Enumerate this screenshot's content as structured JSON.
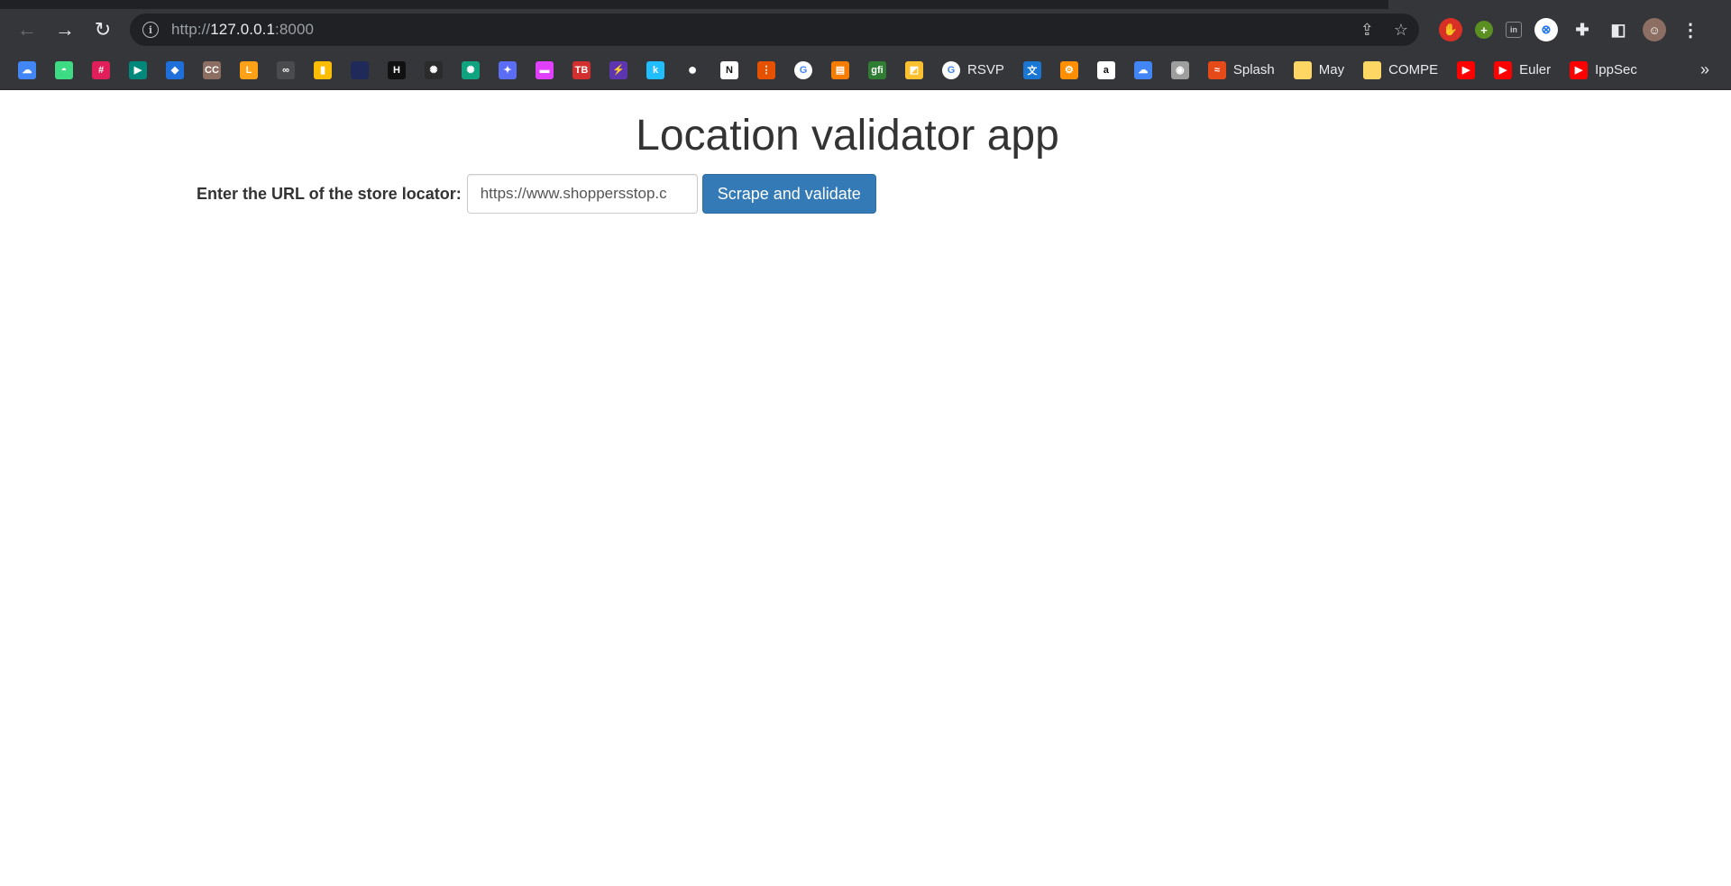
{
  "browser": {
    "url_scheme": "http://",
    "url_host": "127.0.0.1",
    "url_port": ":8000",
    "bookmarks": [
      {
        "label": "",
        "icon": "google-cloud-icon",
        "color": "#4285f4",
        "glyph": "☁"
      },
      {
        "label": "",
        "icon": "android-icon",
        "color": "#3ddc84",
        "glyph": "◓"
      },
      {
        "label": "",
        "icon": "slack-icon",
        "color": "#e01e5a",
        "glyph": "#"
      },
      {
        "label": "",
        "icon": "google-meet-icon",
        "color": "#00897b",
        "glyph": "▶"
      },
      {
        "label": "",
        "icon": "binance-icon",
        "color": "#1e6fd9",
        "glyph": "◆"
      },
      {
        "label": "",
        "icon": "cc-icon",
        "color": "#8d6e63",
        "glyph": "CC"
      },
      {
        "label": "",
        "icon": "leetcode-icon",
        "color": "#ffa116",
        "glyph": "L"
      },
      {
        "label": "",
        "icon": "mask-icon",
        "color": "#4a4b4f",
        "glyph": "∞"
      },
      {
        "label": "",
        "icon": "bar-chart-icon",
        "color": "#fbbc04",
        "glyph": "▮"
      },
      {
        "label": "",
        "icon": "dark-square-icon",
        "color": "#1f2a5a",
        "glyph": " "
      },
      {
        "label": "",
        "icon": "hackerrank-icon",
        "color": "#111111",
        "glyph": "H"
      },
      {
        "label": "",
        "icon": "openai-icon",
        "color": "#2b2b2b",
        "glyph": "✺"
      },
      {
        "label": "",
        "icon": "chatgpt-icon",
        "color": "#10a37f",
        "glyph": "✺"
      },
      {
        "label": "",
        "icon": "gemini-icon",
        "color": "#5b6df5",
        "glyph": "✦"
      },
      {
        "label": "",
        "icon": "stripe-icon",
        "color": "#e040fb",
        "glyph": "▬"
      },
      {
        "label": "",
        "icon": "tb-icon",
        "color": "#d32f2f",
        "glyph": "TB"
      },
      {
        "label": "",
        "icon": "bolt-icon",
        "color": "#5e35b1",
        "glyph": "⚡"
      },
      {
        "label": "",
        "icon": "kaggle-icon",
        "color": "#20beff",
        "glyph": "k"
      },
      {
        "label": "",
        "icon": "github-icon",
        "color": "#ffffff",
        "glyph": "●"
      },
      {
        "label": "",
        "icon": "notion-icon",
        "color": "#ffffff",
        "glyph": "N"
      },
      {
        "label": "",
        "icon": "flow-icon",
        "color": "#e65100",
        "glyph": "⋮"
      },
      {
        "label": "",
        "icon": "google-icon",
        "color": "#ffffff",
        "glyph": "G"
      },
      {
        "label": "",
        "icon": "book-icon",
        "color": "#f57c00",
        "glyph": "▤"
      },
      {
        "label": "",
        "icon": "gfi-icon",
        "color": "#2e7d32",
        "glyph": "gfi"
      },
      {
        "label": "",
        "icon": "slides-icon",
        "color": "#fbc02d",
        "glyph": "◩"
      },
      {
        "label": "RSVP",
        "icon": "google-icon",
        "color": "#ffffff",
        "glyph": "G"
      },
      {
        "label": "",
        "icon": "translate-icon",
        "color": "#1976d2",
        "glyph": "文"
      },
      {
        "label": "",
        "icon": "gear-icon",
        "color": "#ff8f00",
        "glyph": "⚙"
      },
      {
        "label": "",
        "icon": "amazon-icon",
        "color": "#ffffff",
        "glyph": "a"
      },
      {
        "label": "",
        "icon": "google-cloud-icon",
        "color": "#4285f4",
        "glyph": "☁"
      },
      {
        "label": "",
        "icon": "incognito-icon",
        "color": "#9e9e9e",
        "glyph": "◉"
      },
      {
        "label": "Splash",
        "icon": "splash-icon",
        "color": "#e64a19",
        "glyph": "≈"
      },
      {
        "label": "May",
        "icon": "folder-note-icon",
        "color": "#fdd663",
        "glyph": " "
      },
      {
        "label": "COMPE",
        "icon": "folder-note-icon",
        "color": "#fdd663",
        "glyph": " "
      },
      {
        "label": "",
        "icon": "youtube-icon",
        "color": "#ff0000",
        "glyph": "▶"
      },
      {
        "label": "Euler",
        "icon": "youtube-icon",
        "color": "#ff0000",
        "glyph": "▶"
      },
      {
        "label": "IppSec",
        "icon": "youtube-icon",
        "color": "#ff0000",
        "glyph": "▶"
      }
    ]
  },
  "app": {
    "title": "Location validator app",
    "url_label": "Enter the URL of the store locator:",
    "url_value": "https://www.shoppersstop.c",
    "submit_label": "Scrape and validate"
  }
}
